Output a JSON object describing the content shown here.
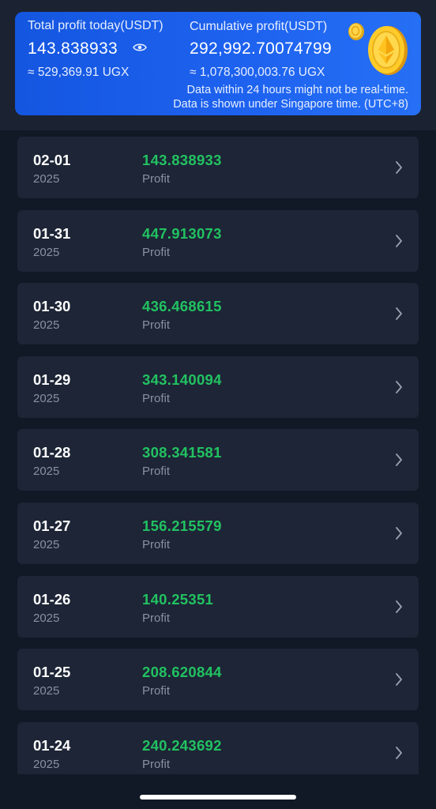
{
  "summary": {
    "today_label": "Total profit today(USDT)",
    "today_value": "143.838933",
    "today_local": "≈ 529,369.91 UGX",
    "cumulative_label": "Cumulative profit(USDT)",
    "cumulative_value": "292,992.70074799",
    "cumulative_local": "≈ 1,078,300,003.76 UGX",
    "note_realtime": "Data within 24 hours might not be real-time.",
    "note_timezone": "Data is shown under Singapore time. (UTC+8)",
    "visibility_icon": "eye-icon",
    "coin_icon": "ethereum-coin-icon"
  },
  "rows": [
    {
      "date": "02-01",
      "year": "2025",
      "value": "143.838933",
      "caption": "Profit"
    },
    {
      "date": "01-31",
      "year": "2025",
      "value": "447.913073",
      "caption": "Profit"
    },
    {
      "date": "01-30",
      "year": "2025",
      "value": "436.468615",
      "caption": "Profit"
    },
    {
      "date": "01-29",
      "year": "2025",
      "value": "343.140094",
      "caption": "Profit"
    },
    {
      "date": "01-28",
      "year": "2025",
      "value": "308.341581",
      "caption": "Profit"
    },
    {
      "date": "01-27",
      "year": "2025",
      "value": "156.215579",
      "caption": "Profit"
    },
    {
      "date": "01-26",
      "year": "2025",
      "value": "140.25351",
      "caption": "Profit"
    },
    {
      "date": "01-25",
      "year": "2025",
      "value": "208.620844",
      "caption": "Profit"
    },
    {
      "date": "01-24",
      "year": "2025",
      "value": "240.243692",
      "caption": "Profit"
    }
  ],
  "colors": {
    "card": "#1e63f0",
    "profit": "#22c261",
    "row_bg": "#1d2536",
    "page_bg": "#111826"
  }
}
